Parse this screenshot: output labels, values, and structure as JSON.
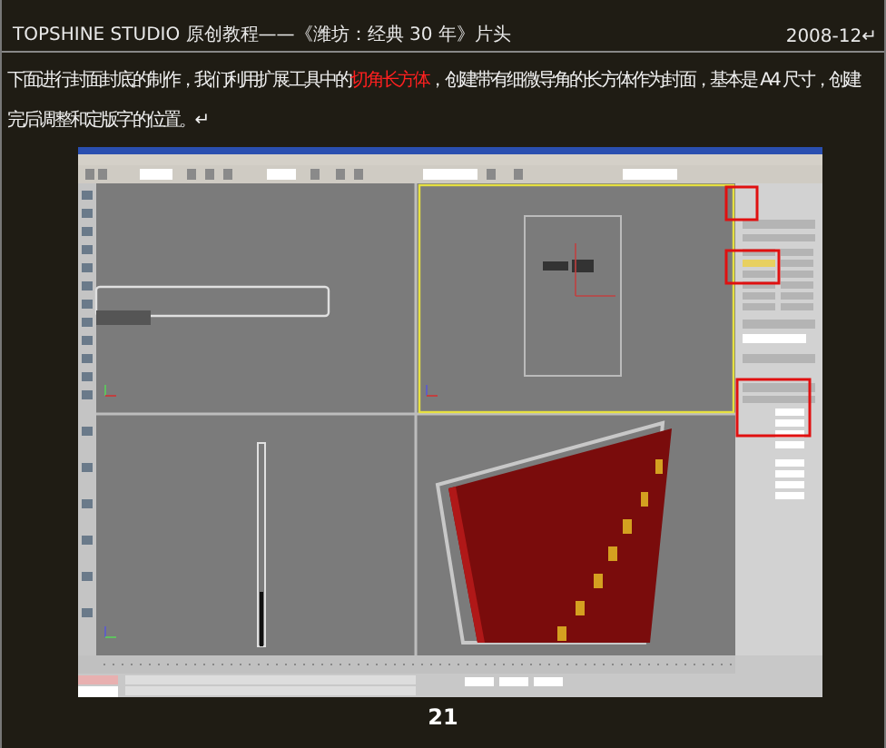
{
  "header": {
    "title": "TOPSHINE STUDIO 原创教程——《潍坊：经典 30 年》片头",
    "date": "2008-12↵"
  },
  "paragraph": {
    "lines": [
      [
        {
          "text": "下面进行封面封底的制作，我们利用扩展工具中的",
          "highlight": false
        },
        {
          "text": "切角长方体",
          "highlight": true
        },
        {
          "text": "，创建带有细微导角的长方体作为封面，基本是 A4 尺寸，创建",
          "highlight": false
        }
      ],
      [
        {
          "text": "完后调整和定版字的位置。↵",
          "highlight": false
        }
      ]
    ]
  },
  "page_number": "21"
}
